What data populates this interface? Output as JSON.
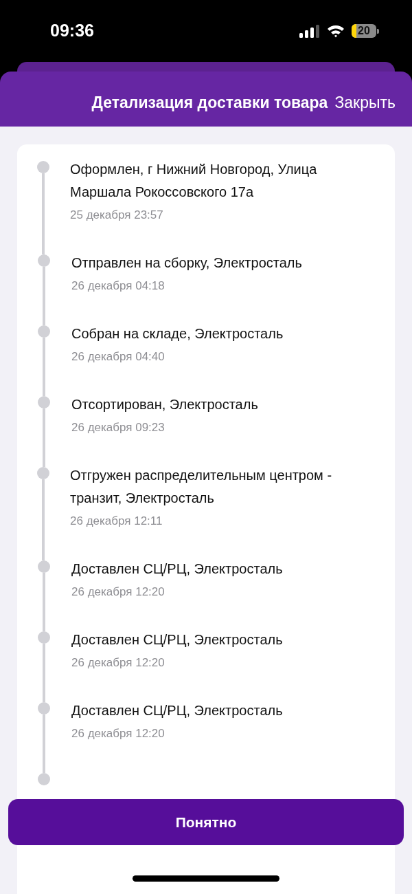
{
  "status_bar": {
    "time": "09:36",
    "battery": "20"
  },
  "header": {
    "title": "Детализация доставки товара",
    "close": "Закрыть"
  },
  "events": [
    {
      "title": "Оформлен, г Нижний Новгород, Улица Маршала Рокоссовского 17а",
      "date": "25 декабря 23:57"
    },
    {
      "title": "Отправлен на сборку, Электросталь",
      "date": "26 декабря 04:18"
    },
    {
      "title": "Собран на складе, Электросталь",
      "date": "26 декабря 04:40"
    },
    {
      "title": "Отсортирован, Электросталь",
      "date": "26 декабря 09:23"
    },
    {
      "title": "Отгружен распределительным центром - транзит, Электросталь",
      "date": "26 декабря 12:11"
    },
    {
      "title": "Доставлен СЦ/РЦ, Электросталь",
      "date": "26 декабря 12:20"
    },
    {
      "title": "Доставлен СЦ/РЦ, Электросталь",
      "date": "26 декабря 12:20"
    },
    {
      "title": "Доставлен СЦ/РЦ, Электросталь",
      "date": "26 декабря 12:20"
    }
  ],
  "button": "Понятно"
}
